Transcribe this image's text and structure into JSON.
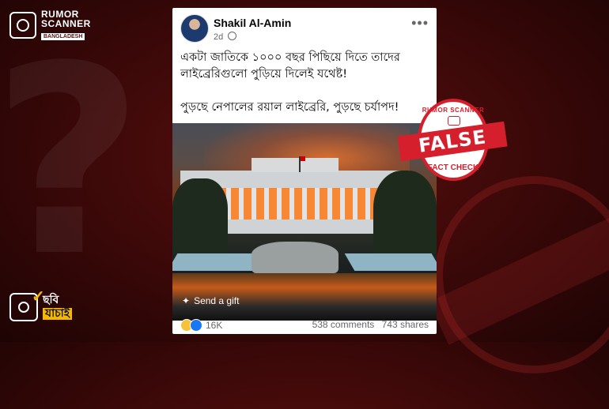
{
  "brand_top": {
    "line1": "RUMOR",
    "line2": "SCANNER",
    "line3": "BANGLADESH"
  },
  "brand_bottom": {
    "line1": "ছবি",
    "line2": "যাচাই"
  },
  "post": {
    "author": "Shakil Al-Amin",
    "time": "2d",
    "text_para1": "একটা জাতিকে ১০০০ বছর পিছিয়ে দিতে তাদের লাইব্রেরিগুলো পুড়িয়ে দিলেই যথেষ্ট!",
    "text_para2": "পুড়ছে নেপালের রয়াল লাইব্রেরি, পুড়ছে চর্যাপদ!",
    "gift_label": "Send a gift",
    "reactions_count": "16K",
    "comments": "538 comments",
    "shares": "743 shares"
  },
  "stamp": {
    "ring_text": "RUMOR SCANNER",
    "verdict": "FALSE",
    "subtitle": "FACT CHECK",
    "color": "#d61f2c"
  }
}
